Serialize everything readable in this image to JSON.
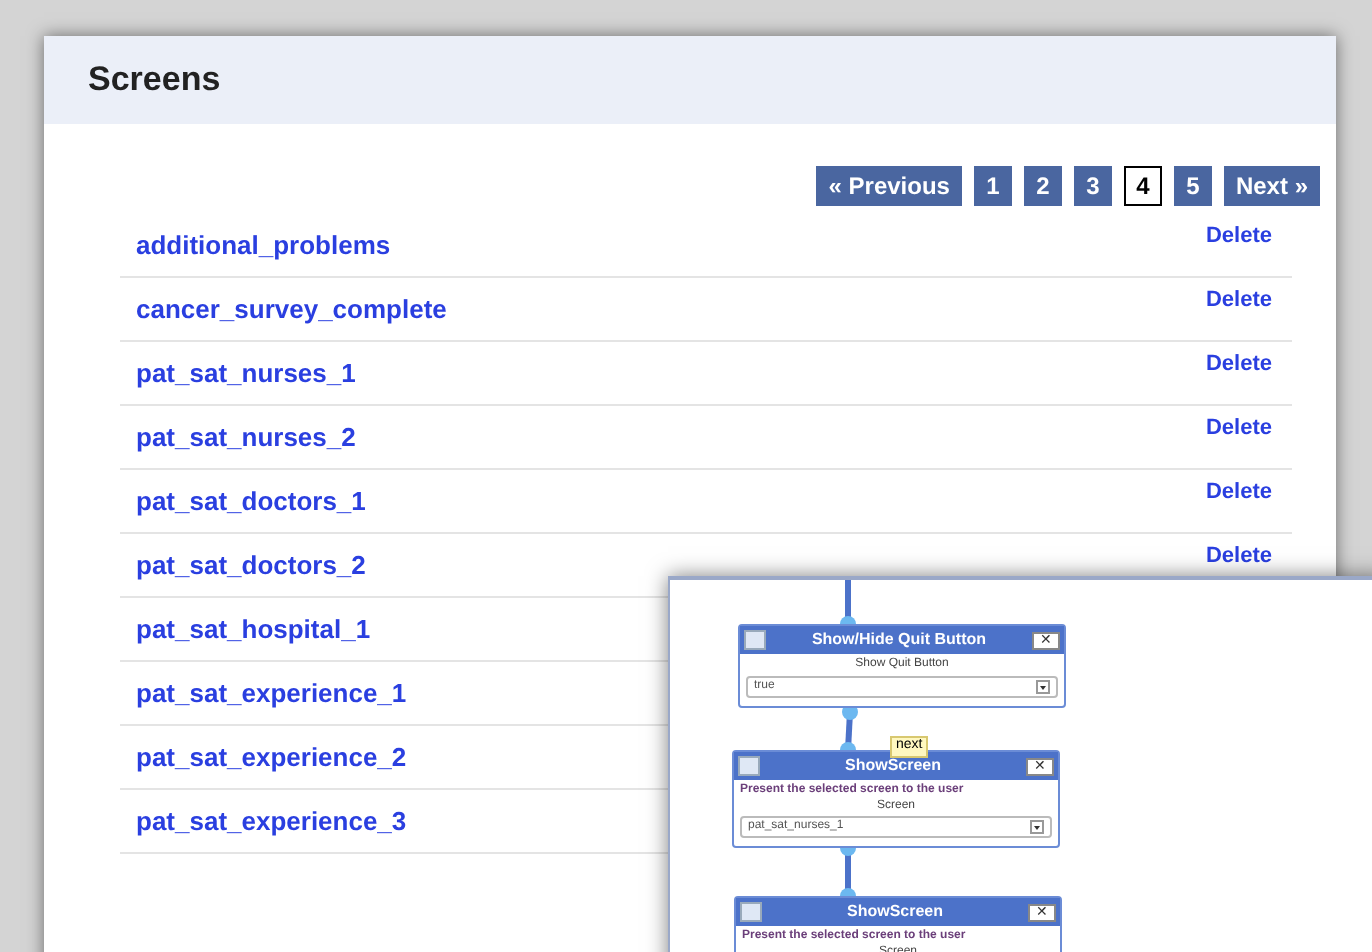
{
  "panel": {
    "title": "Screens"
  },
  "pagination": {
    "previous": "« Previous",
    "next": "Next »",
    "pages": [
      {
        "label": "1",
        "selected": false
      },
      {
        "label": "2",
        "selected": false
      },
      {
        "label": "3",
        "selected": false
      },
      {
        "label": "4",
        "selected": true
      },
      {
        "label": "5",
        "selected": false
      }
    ]
  },
  "screens": [
    {
      "name": "additional_problems",
      "delete": "Delete"
    },
    {
      "name": "cancer_survey_complete",
      "delete": "Delete"
    },
    {
      "name": "pat_sat_nurses_1",
      "delete": "Delete"
    },
    {
      "name": "pat_sat_nurses_2",
      "delete": "Delete"
    },
    {
      "name": "pat_sat_doctors_1",
      "delete": "Delete"
    },
    {
      "name": "pat_sat_doctors_2",
      "delete": "Delete"
    },
    {
      "name": "pat_sat_hospital_1"
    },
    {
      "name": "pat_sat_experience_1"
    },
    {
      "name": "pat_sat_experience_2"
    },
    {
      "name": "pat_sat_experience_3"
    }
  ],
  "flow_editor": {
    "nodes": [
      {
        "title": "Show/Hide Quit Button",
        "close": "✕",
        "field_label": "Show Quit Button",
        "value": "true"
      },
      {
        "title": "ShowScreen",
        "close": "✕",
        "description": "Present the selected screen to the user",
        "field_label": "Screen",
        "value": "pat_sat_nurses_1"
      },
      {
        "title": "ShowScreen",
        "close": "✕",
        "description": "Present the selected screen to the user",
        "field_label": "Screen"
      }
    ],
    "tooltip": "next"
  }
}
